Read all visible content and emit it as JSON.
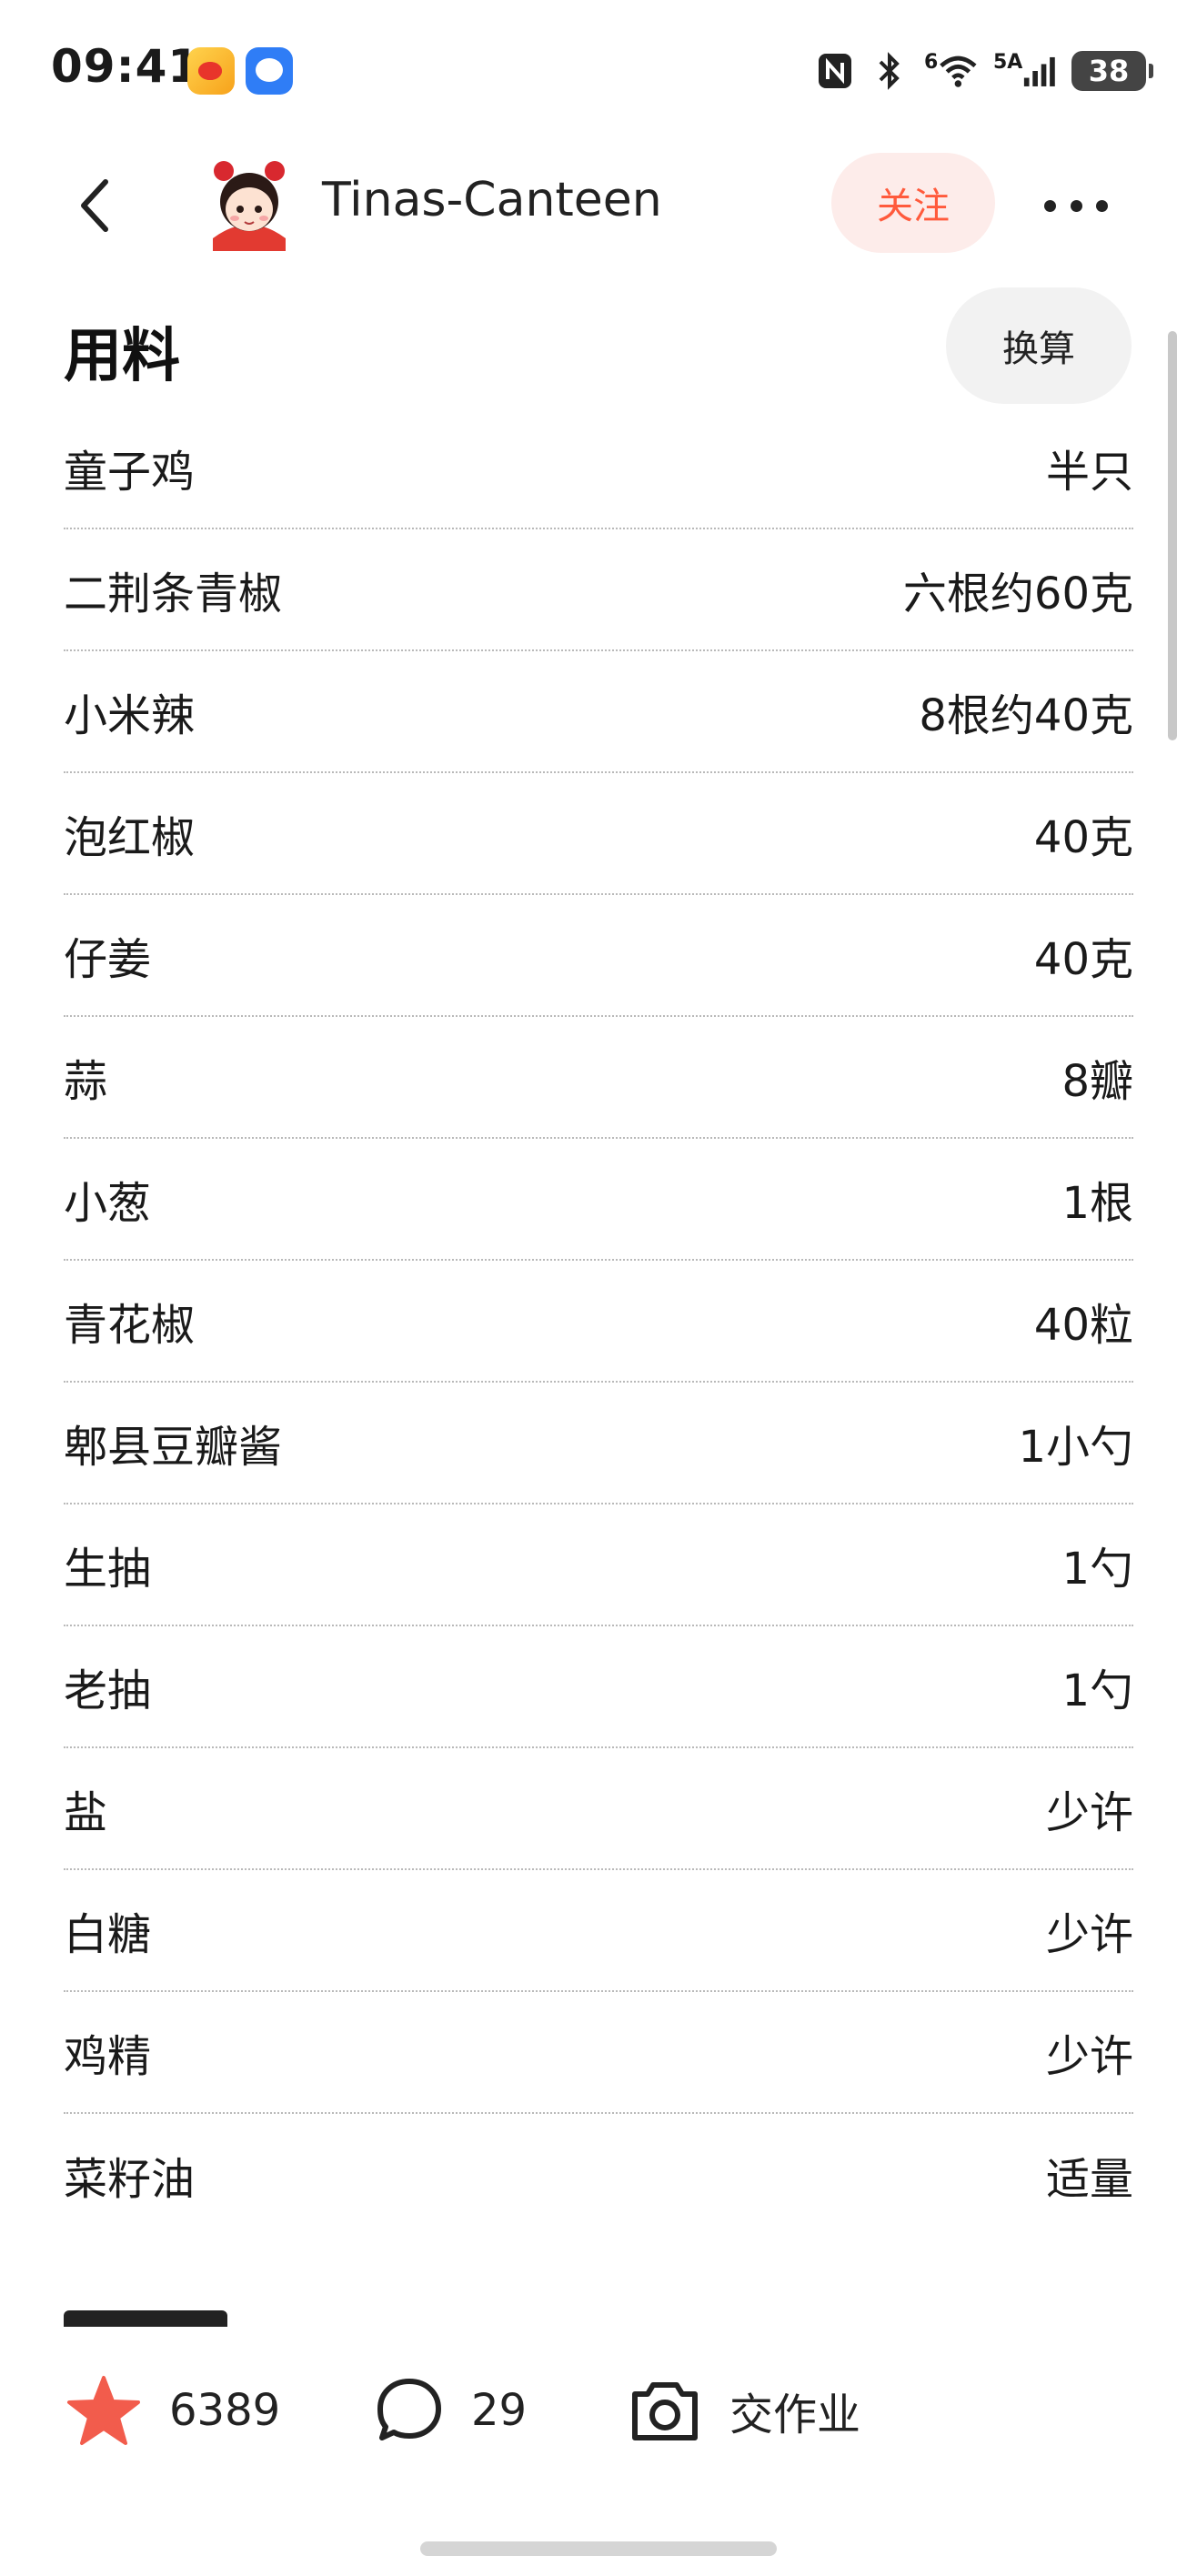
{
  "status_bar": {
    "time": "09:41",
    "network": "5A",
    "wifi_label": "6",
    "battery": "38"
  },
  "header": {
    "author_name": "Tinas-Canteen",
    "follow_label": "关注"
  },
  "ingredients": {
    "title": "用料",
    "convert_label": "换算",
    "items": [
      {
        "name": "童子鸡",
        "amount": "半只"
      },
      {
        "name": "二荆条青椒",
        "amount": "六根约60克"
      },
      {
        "name": "小米辣",
        "amount": "8根约40克"
      },
      {
        "name": "泡红椒",
        "amount": "40克"
      },
      {
        "name": "仔姜",
        "amount": "40克"
      },
      {
        "name": "蒜",
        "amount": "8瓣"
      },
      {
        "name": "小葱",
        "amount": "1根"
      },
      {
        "name": "青花椒",
        "amount": "40粒"
      },
      {
        "name": "郫县豆瓣酱",
        "amount": "1小勺"
      },
      {
        "name": "生抽",
        "amount": "1勺"
      },
      {
        "name": "老抽",
        "amount": "1勺"
      },
      {
        "name": "盐",
        "amount": "少许"
      },
      {
        "name": "白糖",
        "amount": "少许"
      },
      {
        "name": "鸡精",
        "amount": "少许"
      },
      {
        "name": "菜籽油",
        "amount": "适量"
      }
    ]
  },
  "bottom_bar": {
    "favorites": "6389",
    "comments": "29",
    "homework_label": "交作业"
  },
  "colors": {
    "accent": "#ff5a3c",
    "follow_bg": "#fdecea",
    "star": "#f25c4c"
  }
}
